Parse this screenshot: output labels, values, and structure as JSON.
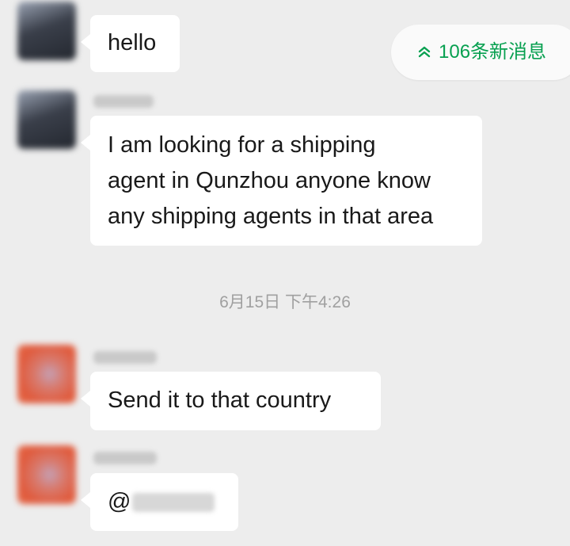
{
  "new_messages": {
    "label": "106条新消息"
  },
  "messages": [
    {
      "text": "hello"
    },
    {
      "text": "I am looking for a shipping\nagent in Qunzhou anyone know\nany shipping agents in that area"
    },
    {
      "text": "Send it to that country"
    },
    {
      "text": "@"
    }
  ],
  "timestamp": "6月15日 下午4:26",
  "colors": {
    "background": "#ededed",
    "bubble": "#ffffff",
    "accent_green": "#07a050",
    "timestamp_gray": "#a0a0a0"
  }
}
